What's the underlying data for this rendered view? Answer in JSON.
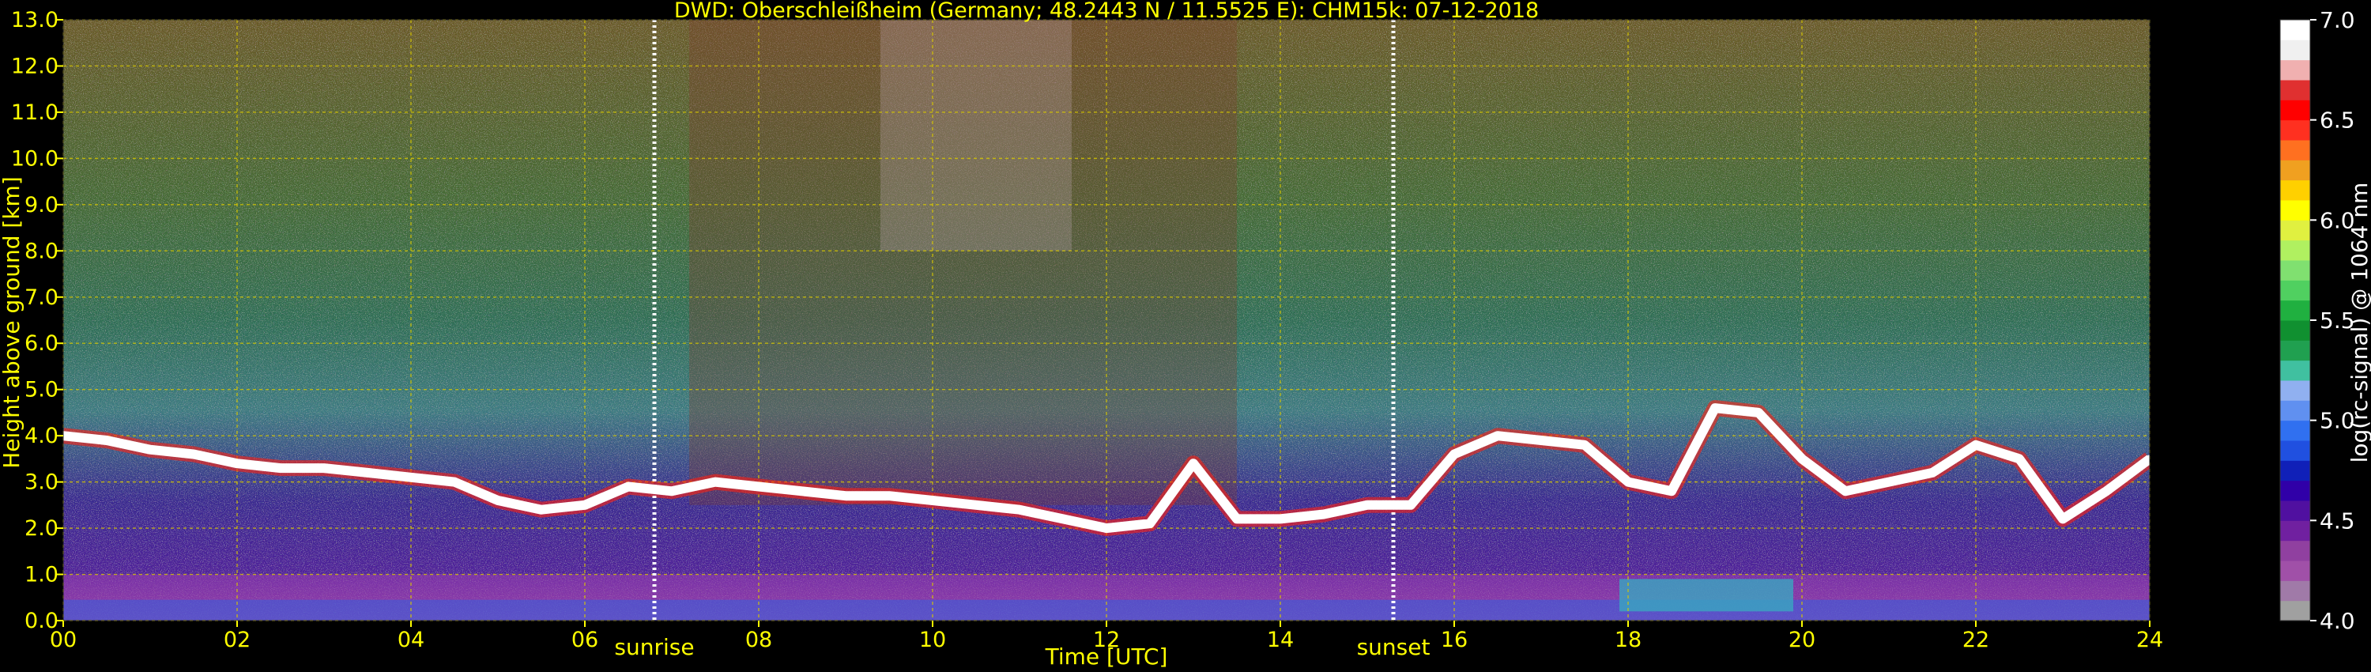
{
  "chart_data": {
    "type": "heatmap",
    "title": "DWD: Oberschleißheim (Germany; 48.2443 N / 11.5525 E):    CHM15k: 07-12-2018",
    "xlabel": "Time [UTC]",
    "ylabel": "Height above ground [km]",
    "xlim": [
      0,
      24
    ],
    "ylim": [
      0,
      13
    ],
    "x_ticks": [
      "00",
      "02",
      "04",
      "06",
      "08",
      "10",
      "12",
      "14",
      "16",
      "18",
      "20",
      "22",
      "24"
    ],
    "x_tick_values": [
      0,
      2,
      4,
      6,
      8,
      10,
      12,
      14,
      16,
      18,
      20,
      22,
      24
    ],
    "y_ticks": [
      "0.0",
      "1.0",
      "2.0",
      "3.0",
      "4.0",
      "5.0",
      "6.0",
      "7.0",
      "8.0",
      "9.0",
      "10.0",
      "11.0",
      "12.0",
      "13.0"
    ],
    "y_tick_values": [
      0,
      1,
      2,
      3,
      4,
      5,
      6,
      7,
      8,
      9,
      10,
      11,
      12,
      13
    ],
    "grid": true,
    "annotations": [
      {
        "text": "sunrise",
        "x": 6.8
      },
      {
        "text": "sunset",
        "x": 15.3
      }
    ],
    "colorbar": {
      "label": "log(rc-signal) @ 1064 nm",
      "range": [
        4.0,
        7.0
      ],
      "ticks": [
        "4.0",
        "4.5",
        "5.0",
        "5.5",
        "6.0",
        "6.5",
        "7.0"
      ],
      "tick_values": [
        4.0,
        4.5,
        5.0,
        5.5,
        6.0,
        6.5,
        7.0
      ],
      "colors": [
        "#a0a0a0",
        "#a07aa8",
        "#a050a8",
        "#9040a0",
        "#7020a0",
        "#5010a0",
        "#3000a8",
        "#1020b8",
        "#2050e0",
        "#3070f0",
        "#6090f0",
        "#90b0f0",
        "#40c0a0",
        "#20a050",
        "#109030",
        "#20b040",
        "#50d060",
        "#80e070",
        "#b0f060",
        "#e0f040",
        "#ffff00",
        "#ffd000",
        "#f0a020",
        "#ff7020",
        "#ff3020",
        "#ff0000",
        "#e03030",
        "#f0b0b0",
        "#f0f0f0",
        "#ffffff"
      ]
    },
    "series": [
      {
        "name": "",
        "x": [
          0,
          0.5,
          1,
          1.5,
          2,
          2.5,
          3,
          3.5,
          4,
          4.5,
          5,
          5.5,
          6,
          6.5,
          7,
          7.5,
          8,
          8.5,
          9,
          9.5,
          10,
          10.5,
          11,
          11.5,
          12,
          12.5,
          13,
          13.5,
          14,
          14.5,
          15,
          15.5,
          16,
          16.5,
          17,
          17.5,
          18,
          18.5,
          19,
          19.5,
          20,
          20.5,
          21,
          21.5,
          22,
          22.5,
          23,
          23.5,
          24
        ],
        "y": [
          4.0,
          3.9,
          3.7,
          3.6,
          3.4,
          3.3,
          3.3,
          3.2,
          3.1,
          3.0,
          2.6,
          2.4,
          2.5,
          2.9,
          2.8,
          3.0,
          2.9,
          2.8,
          2.7,
          2.7,
          2.6,
          2.5,
          2.4,
          2.2,
          2.0,
          2.1,
          3.4,
          2.2,
          2.2,
          2.3,
          2.5,
          2.5,
          3.6,
          4.0,
          3.9,
          3.8,
          3.0,
          2.8,
          4.6,
          4.5,
          3.5,
          2.8,
          3.0,
          3.2,
          3.8,
          3.5,
          2.2,
          2.8,
          3.5
        ]
      }
    ]
  }
}
